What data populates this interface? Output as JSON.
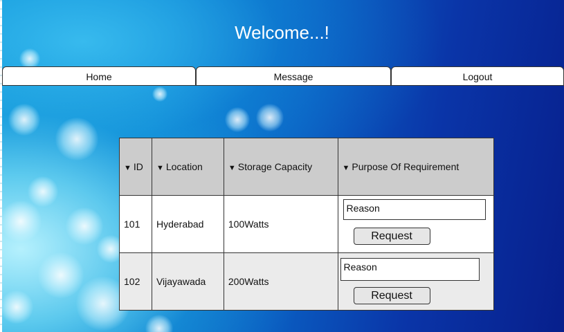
{
  "header": {
    "title": "Welcome...!"
  },
  "nav": {
    "tabs": [
      {
        "label": "Home"
      },
      {
        "label": "Message"
      },
      {
        "label": "Logout"
      }
    ]
  },
  "table": {
    "sort_icon": "▼",
    "columns": [
      "ID",
      "Location",
      "Storage Capacity",
      "Purpose Of Requirement"
    ],
    "rows": [
      {
        "id": "101",
        "location": "Hyderabad",
        "capacity": "100Watts",
        "reason_value": "Reason",
        "button_label": "Request"
      },
      {
        "id": "102",
        "location": "Vijayawada",
        "capacity": "200Watts",
        "reason_value": "Reason",
        "button_label": "Request"
      }
    ]
  },
  "colors": {
    "header_row_bg": "#cccccc",
    "alt_row_bg": "#ebebeb",
    "button_bg": "#e6e6e6",
    "background_accent": "#0a5fc2"
  },
  "icons": {
    "sort": "sort-descending-icon"
  }
}
